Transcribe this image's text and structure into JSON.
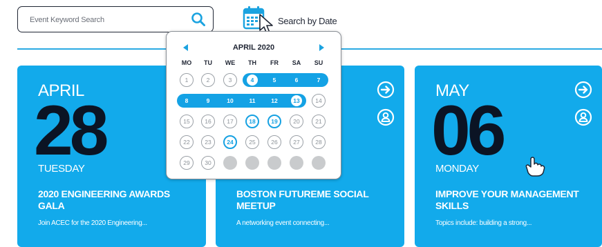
{
  "search": {
    "placeholder": "Event Keyword Search",
    "icon": "search-icon"
  },
  "date_search": {
    "label": "Search by Date",
    "icon": "calendar-icon"
  },
  "colors": {
    "accent": "#12aaeb",
    "dark": "#0b1424"
  },
  "calendar": {
    "month_label": "APRIL 2020",
    "weekdays": [
      "MO",
      "TU",
      "WE",
      "TH",
      "FR",
      "SA",
      "SU"
    ],
    "weeks": [
      [
        {
          "d": "1",
          "s": "past"
        },
        {
          "d": "2",
          "s": "past"
        },
        {
          "d": "3",
          "s": "past"
        },
        {
          "d": "4",
          "s": "event"
        },
        {
          "d": "5",
          "s": "inband"
        },
        {
          "d": "6",
          "s": "inband"
        },
        {
          "d": "7",
          "s": "inband"
        }
      ],
      [
        {
          "d": "8",
          "s": "inband"
        },
        {
          "d": "9",
          "s": "inband"
        },
        {
          "d": "10",
          "s": "inband"
        },
        {
          "d": "11",
          "s": "inband"
        },
        {
          "d": "12",
          "s": "inband"
        },
        {
          "d": "13",
          "s": "event"
        },
        {
          "d": "14",
          "s": "past"
        }
      ],
      [
        {
          "d": "15",
          "s": "past"
        },
        {
          "d": "16",
          "s": "past"
        },
        {
          "d": "17",
          "s": "past"
        },
        {
          "d": "18",
          "s": "event"
        },
        {
          "d": "19",
          "s": "event"
        },
        {
          "d": "20",
          "s": "past"
        },
        {
          "d": "21",
          "s": "past"
        }
      ],
      [
        {
          "d": "22",
          "s": "past"
        },
        {
          "d": "23",
          "s": "past"
        },
        {
          "d": "24",
          "s": "event"
        },
        {
          "d": "25",
          "s": "past"
        },
        {
          "d": "26",
          "s": "past"
        },
        {
          "d": "27",
          "s": "past"
        },
        {
          "d": "28",
          "s": "past"
        }
      ],
      [
        {
          "d": "29",
          "s": "past"
        },
        {
          "d": "30",
          "s": "past"
        },
        {
          "d": "",
          "s": "empty"
        },
        {
          "d": "",
          "s": "empty"
        },
        {
          "d": "",
          "s": "empty"
        },
        {
          "d": "",
          "s": "empty"
        },
        {
          "d": "",
          "s": "empty"
        }
      ]
    ]
  },
  "events": [
    {
      "month": "APRIL",
      "day": "28",
      "weekday": "TUESDAY",
      "title": "2020 ENGINEERING AWARDS GALA",
      "description": "Join ACEC for the 2020 Engineering..."
    },
    {
      "month": "",
      "day": "",
      "weekday": "",
      "title": "BOSTON FUTUREME SOCIAL MEETUP",
      "description": "A networking event connecting..."
    },
    {
      "month": "MAY",
      "day": "06",
      "weekday": "MONDAY",
      "title": "IMPROVE YOUR MANAGEMENT SKILLS",
      "description": "Topics include: building a strong..."
    }
  ]
}
